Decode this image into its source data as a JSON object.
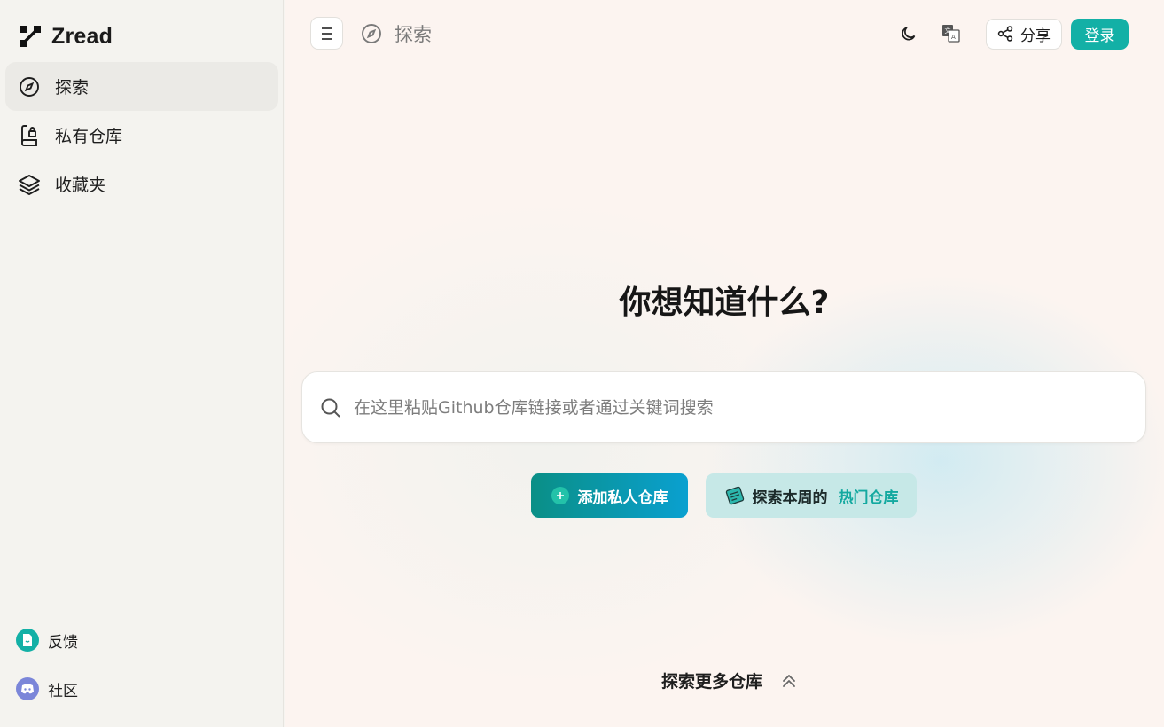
{
  "app": {
    "name": "Zread"
  },
  "sidebar": {
    "items": [
      {
        "label": "探索",
        "icon": "compass-icon",
        "active": true
      },
      {
        "label": "私有仓库",
        "icon": "private-repo-icon",
        "active": false
      },
      {
        "label": "收藏夹",
        "icon": "layers-icon",
        "active": false
      }
    ],
    "bottom": [
      {
        "label": "反馈",
        "icon": "feedback-icon",
        "color": "#13b0a6"
      },
      {
        "label": "社区",
        "icon": "discord-icon",
        "color": "#7b86d9"
      }
    ]
  },
  "header": {
    "breadcrumb": "探索",
    "share_label": "分享",
    "login_label": "登录"
  },
  "hero": {
    "title": "你想知道什么?",
    "search_placeholder": "在这里粘贴Github仓库链接或者通过关键词搜索",
    "add_private_label": "添加私人仓库",
    "explore_prefix": "探索本周的",
    "explore_accent": "热门仓库",
    "more_label": "探索更多仓库"
  },
  "colors": {
    "accent": "#13b0a6",
    "sidebar_bg": "#f4f3ef",
    "main_bg": "#fcf4f0"
  }
}
